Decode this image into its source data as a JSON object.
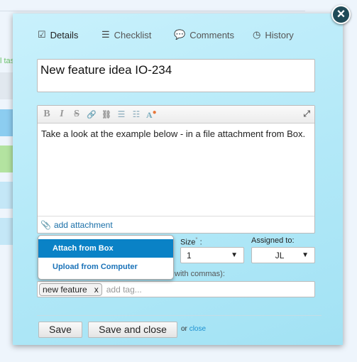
{
  "background": {
    "partial_link": "l tas"
  },
  "tabs": [
    {
      "label": "Details",
      "icon": "checkbox-icon",
      "active": true
    },
    {
      "label": "Checklist",
      "icon": "list-icon"
    },
    {
      "label": "Comments",
      "icon": "comments-icon"
    },
    {
      "label": "History",
      "icon": "clock-icon"
    }
  ],
  "title_value": "New feature idea IO-234",
  "editor": {
    "toolbar": [
      "B",
      "I",
      "S",
      "link",
      "unlink",
      "bullets",
      "numbers",
      "remove-format"
    ],
    "content": "Take a look at the example below - in a file attachment from Box.",
    "add_attachment": "add attachment"
  },
  "fields": {
    "size_label": "Size",
    "size_required": "*",
    "size_colon": " :",
    "size_value": "1",
    "assigned_label": "Assigned to:",
    "assigned_value": "JL",
    "tags_label": "with commas):",
    "tags": [
      {
        "label": "new feature",
        "remove": "x"
      }
    ],
    "tag_placeholder": "add tag..."
  },
  "attach_menu": [
    "Attach from Box",
    "Upload from Computer"
  ],
  "buttons": {
    "save": "Save",
    "save_close": "Save and close",
    "or": "or",
    "close": "close",
    "close_icon": "×"
  },
  "colors": {
    "accent": "#0a82c6",
    "modal_bg": "#b4e9f8"
  }
}
